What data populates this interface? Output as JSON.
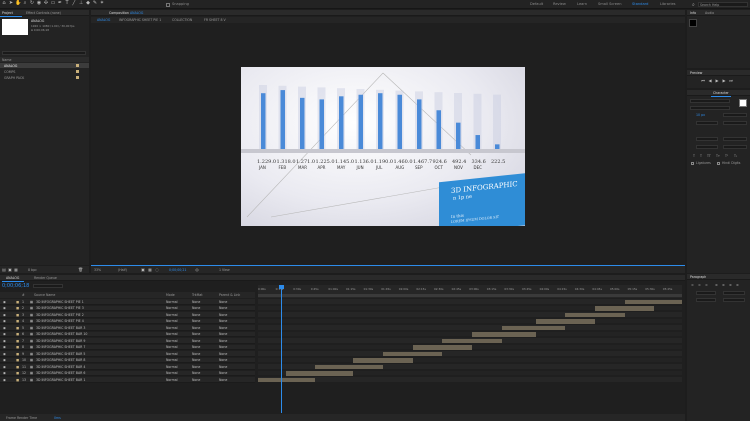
{
  "workspaces": [
    "Default",
    "Review",
    "Learn",
    "Small Screen",
    "Standard",
    "Libraries"
  ],
  "active_workspace": "Standard",
  "search_placeholder": "Search Help",
  "toolbar": {
    "snapping_label": "Snapping"
  },
  "project_panel": {
    "tab": "Project",
    "tab2": "Effect Controls (none)",
    "selected_name": "ANALOG",
    "selected_info": "1920 × 1080 (1.00) / 30,00 fps",
    "selected_duration": "Δ 0;00;06;18",
    "column_name": "Name",
    "items": [
      {
        "name": "ANALOG",
        "color": "#e2c35a"
      },
      {
        "name": "COMPS",
        "color": "#e2c35a"
      },
      {
        "name": "GRAPH PACK",
        "color": "#e2c35a"
      }
    ],
    "bpc": "8 bpc"
  },
  "composition_panel": {
    "tab_prefix": "Composition",
    "tab_name": "ANALOG",
    "breadcrumbs": [
      "ANALOG",
      "INFOGRAPHIC SHEET PIE 1",
      "COLLECTION",
      "FR SHEET 8 V"
    ],
    "zoom": "33%",
    "quality": "(Half)",
    "timecode": "0;00;00;21",
    "camera": "1 View"
  },
  "viewer": {
    "bar_labels": [
      "1.229.0",
      "1.318.0",
      "1.271.0",
      "1.225.0",
      "1.145.0",
      "1.136.0",
      "1.190.0",
      "1.460.0",
      "1.467.7",
      "924.6",
      "492.4",
      "334.6",
      "222.5"
    ],
    "month_labels": [
      "JAN",
      "FEB",
      "MAR",
      "APR",
      "MAY",
      "JUN",
      "JUL",
      "AUG",
      "SEP",
      "OCT",
      "NOV",
      "DEC",
      ""
    ],
    "values": [
      3600,
      3800,
      3300,
      3200,
      3400,
      3500,
      3600,
      3500,
      3200,
      2500,
      1700,
      900,
      300
    ],
    "card_title": "3D INFOGRAPHIC",
    "card_sub": "n 1p ne",
    "card_bottom": "In this",
    "card_bottom2": "LOREM IPSUM DOLOR SIT"
  },
  "right_panel": {
    "tabs": [
      "Info",
      "Audio"
    ],
    "preview_title": "Preview",
    "character_title": "Character",
    "paragraph_title": "Paragraph",
    "font_size": "10 px",
    "ligatures": "Ligatures",
    "hindi_digits": "Hindi Digits"
  },
  "timeline": {
    "tab": "ANALOG",
    "tab2": "Render Queue",
    "timecode": "0;00;06;18",
    "columns": [
      "#",
      "Source Name",
      "Mode",
      "TrkMat",
      "Parent & Link"
    ],
    "ruler": [
      "0:00s",
      "0:15s",
      "0:30s",
      "0:45s",
      "01:00s",
      "01:15s",
      "01:30s",
      "01:45s",
      "02:00s",
      "02:15s",
      "02:30s",
      "02:45s",
      "03:00s",
      "03:15s",
      "03:30s",
      "03:45s",
      "04:00s",
      "04:15s",
      "04:30s",
      "04:45s",
      "05:00s",
      "05:15s",
      "05:30s",
      "05:45s"
    ],
    "layers": [
      {
        "num": "1",
        "name": "3D INFOGRAPHIC SHEET PIE 1",
        "mode": "Normal",
        "trkmat": "None",
        "parent": "None",
        "start": 0.865,
        "end": 1.0
      },
      {
        "num": "2",
        "name": "3D INFOGRAPHIC SHEET PIE 3",
        "mode": "Normal",
        "trkmat": "None",
        "parent": "None",
        "start": 0.795,
        "end": 0.935
      },
      {
        "num": "3",
        "name": "3D INFOGRAPHIC SHEET PIE 2",
        "mode": "Normal",
        "trkmat": "None",
        "parent": "None",
        "start": 0.725,
        "end": 0.865
      },
      {
        "num": "4",
        "name": "3D INFOGRAPHIC SHEET PIE 4",
        "mode": "Normal",
        "trkmat": "None",
        "parent": "None",
        "start": 0.655,
        "end": 0.795
      },
      {
        "num": "5",
        "name": "3D INFOGRAPHIC SHEET BAR 3",
        "mode": "Normal",
        "trkmat": "None",
        "parent": "None",
        "start": 0.575,
        "end": 0.725
      },
      {
        "num": "6",
        "name": "3D INFOGRAPHIC SHEET BAR 10",
        "mode": "Normal",
        "trkmat": "None",
        "parent": "None",
        "start": 0.505,
        "end": 0.655
      },
      {
        "num": "7",
        "name": "3D INFOGRAPHIC SHEET BAR 9",
        "mode": "Normal",
        "trkmat": "None",
        "parent": "None",
        "start": 0.435,
        "end": 0.575
      },
      {
        "num": "8",
        "name": "3D INFOGRAPHIC SHEET BAR 7",
        "mode": "Normal",
        "trkmat": "None",
        "parent": "None",
        "start": 0.365,
        "end": 0.505
      },
      {
        "num": "9",
        "name": "3D INFOGRAPHIC SHEET BAR 5",
        "mode": "Normal",
        "trkmat": "None",
        "parent": "None",
        "start": 0.295,
        "end": 0.435
      },
      {
        "num": "10",
        "name": "3D INFOGRAPHIC SHEET BAR 8",
        "mode": "Normal",
        "trkmat": "None",
        "parent": "None",
        "start": 0.225,
        "end": 0.365
      },
      {
        "num": "11",
        "name": "3D INFOGRAPHIC SHEET BAR 4",
        "mode": "Normal",
        "trkmat": "None",
        "parent": "None",
        "start": 0.135,
        "end": 0.295
      },
      {
        "num": "12",
        "name": "3D INFOGRAPHIC SHEET BAR 6",
        "mode": "Normal",
        "trkmat": "None",
        "parent": "None",
        "start": 0.065,
        "end": 0.225
      },
      {
        "num": "13",
        "name": "3D INFOGRAPHIC SHEET BAR 1",
        "mode": "Normal",
        "trkmat": "None",
        "parent": "None",
        "start": 0.0,
        "end": 0.135
      }
    ],
    "footer": "Frame Render Time",
    "footer_value": "0ms"
  },
  "colors": {
    "accent": "#2d8ceb",
    "bar": "#6b6353",
    "label": "#c9b07a"
  }
}
